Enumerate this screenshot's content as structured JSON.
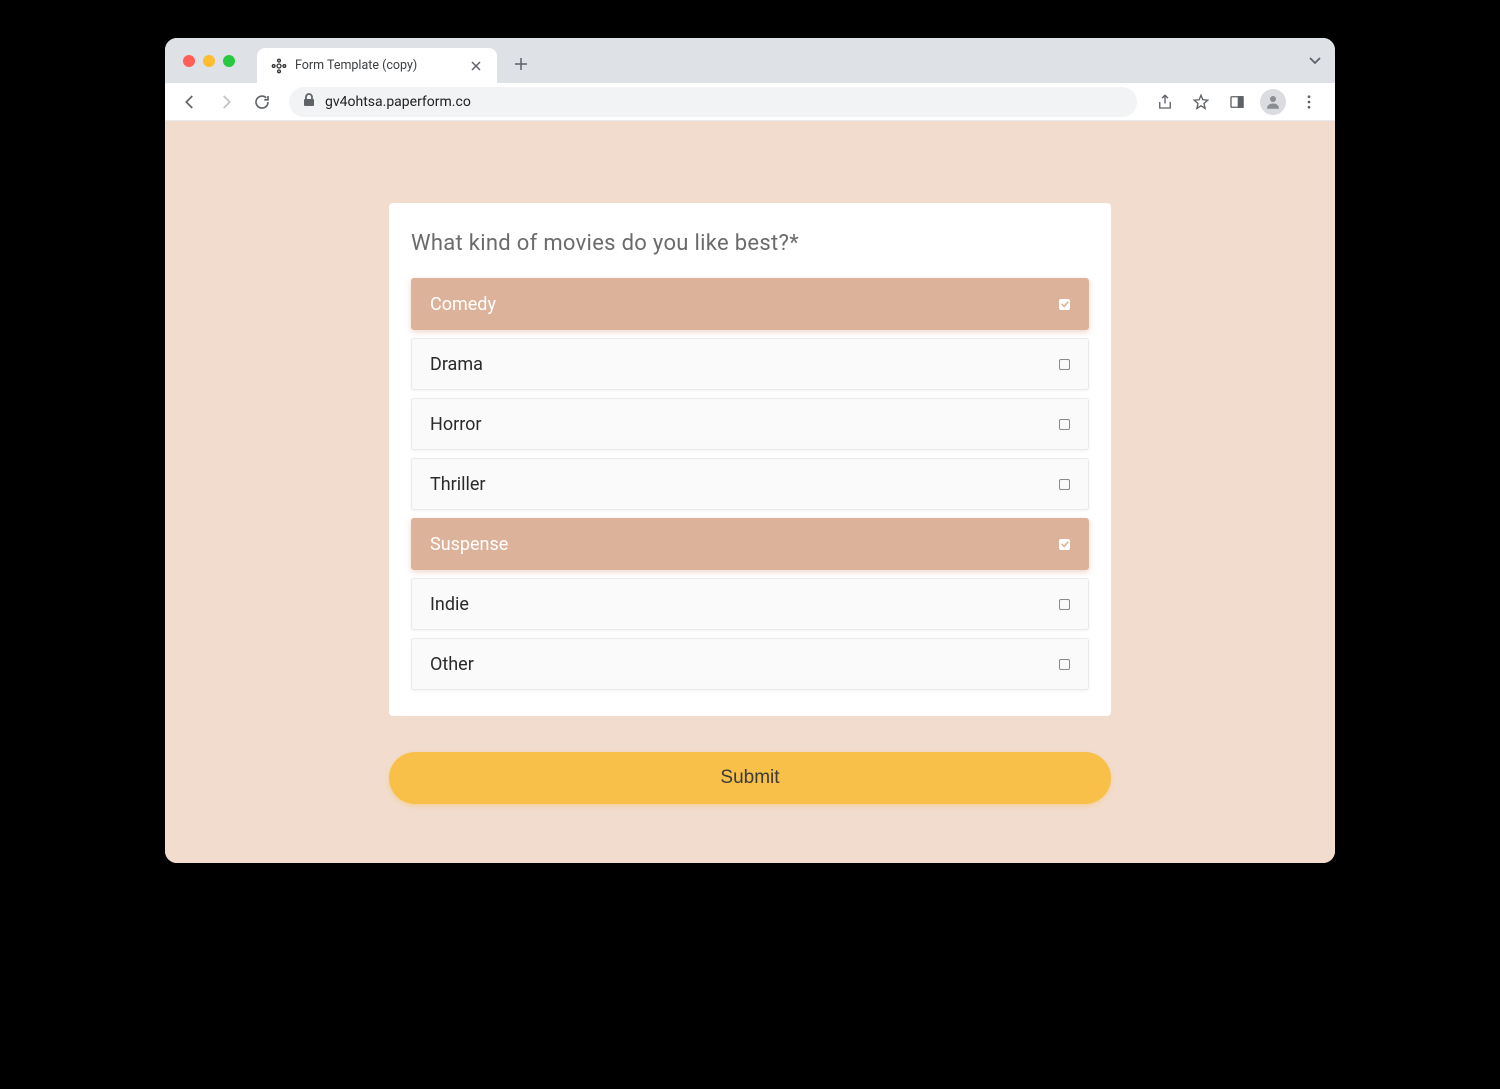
{
  "browser": {
    "tab_title": "Form Template (copy)",
    "url": "gv4ohtsa.paperform.co"
  },
  "form": {
    "question": "What kind of movies do you like best?*",
    "options": [
      {
        "label": "Comedy",
        "selected": true
      },
      {
        "label": "Drama",
        "selected": false
      },
      {
        "label": "Horror",
        "selected": false
      },
      {
        "label": "Thriller",
        "selected": false
      },
      {
        "label": "Suspense",
        "selected": true
      },
      {
        "label": "Indie",
        "selected": false
      },
      {
        "label": "Other",
        "selected": false
      }
    ],
    "submit_label": "Submit"
  },
  "colors": {
    "page_bg": "#f2dcce",
    "selected_bg": "#ddb29a",
    "submit_bg": "#f8c049"
  }
}
